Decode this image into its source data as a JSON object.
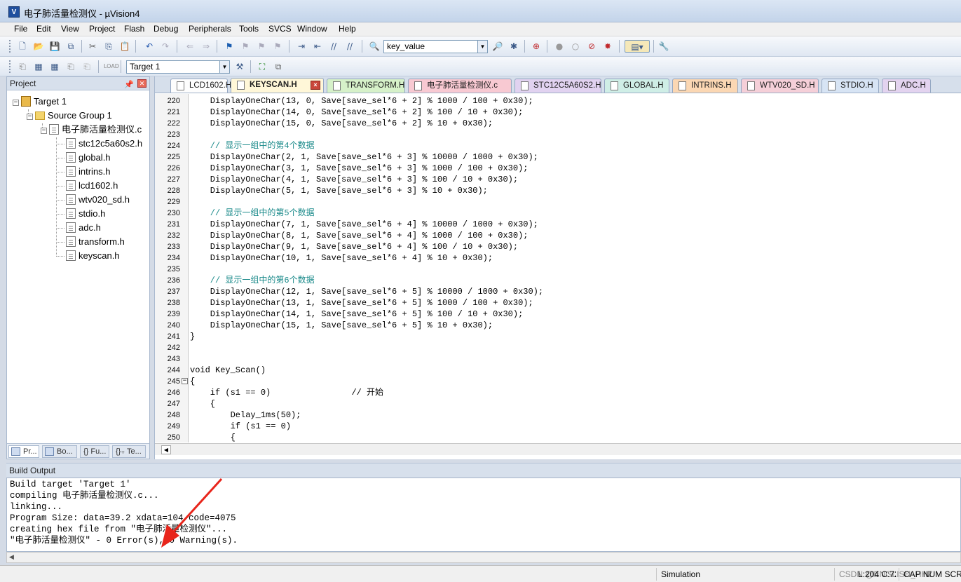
{
  "window": {
    "title": "电子肺活量检测仪  - µVision4",
    "app_icon_label": "V"
  },
  "menu": [
    "File",
    "Edit",
    "View",
    "Project",
    "Flash",
    "Debug",
    "Peripherals",
    "Tools",
    "SVCS",
    "Window",
    "Help"
  ],
  "toolbar": {
    "find_combo_value": "key_value",
    "target_combo_value": "Target 1"
  },
  "project_panel": {
    "title": "Project",
    "tree": {
      "target": "Target 1",
      "group": "Source Group 1",
      "main_file": "电子肺活量检测仪.c",
      "headers": [
        "stc12c5a60s2.h",
        "global.h",
        "intrins.h",
        "lcd1602.h",
        "wtv020_sd.h",
        "stdio.h",
        "adc.h",
        "transform.h",
        "keyscan.h"
      ]
    },
    "tabs": [
      "Pr...",
      "Bo...",
      "{} Fu...",
      "{}₊ Te..."
    ]
  },
  "editor": {
    "tabs": [
      {
        "label": "LCD1602.H",
        "color": "#fdfdfd"
      },
      {
        "label": "KEYSCAN.H",
        "color": "#fff7d8",
        "active": true
      },
      {
        "label": "TRANSFORM.H",
        "color": "#d6f1c9"
      },
      {
        "label": "电子肺活量检测仪.c",
        "color": "#f8c9d2"
      },
      {
        "label": "STC12C5A60S2.H",
        "color": "#e1d2f0"
      },
      {
        "label": "GLOBAL.H",
        "color": "#cfeee6"
      },
      {
        "label": "INTRINS.H",
        "color": "#fbd7b3"
      },
      {
        "label": "WTV020_SD.H",
        "color": "#f5cfd8"
      },
      {
        "label": "STDIO.H",
        "color": "#d7e4f4"
      },
      {
        "label": "ADC.H",
        "color": "#e3d3ef"
      }
    ],
    "lines": [
      {
        "n": "220",
        "t": "    DisplayOneChar(13, 0, Save[save_sel*6 + 2] % 1000 / 100 + 0x30);"
      },
      {
        "n": "221",
        "t": "    DisplayOneChar(14, 0, Save[save_sel*6 + 2] % 100 / 10 + 0x30);"
      },
      {
        "n": "222",
        "t": "    DisplayOneChar(15, 0, Save[save_sel*6 + 2] % 10 + 0x30);"
      },
      {
        "n": "223",
        "t": ""
      },
      {
        "n": "224",
        "t": "    // 显示一组中的第4个数据",
        "comment": true
      },
      {
        "n": "225",
        "t": "    DisplayOneChar(2, 1, Save[save_sel*6 + 3] % 10000 / 1000 + 0x30);"
      },
      {
        "n": "226",
        "t": "    DisplayOneChar(3, 1, Save[save_sel*6 + 3] % 1000 / 100 + 0x30);"
      },
      {
        "n": "227",
        "t": "    DisplayOneChar(4, 1, Save[save_sel*6 + 3] % 100 / 10 + 0x30);"
      },
      {
        "n": "228",
        "t": "    DisplayOneChar(5, 1, Save[save_sel*6 + 3] % 10 + 0x30);"
      },
      {
        "n": "229",
        "t": ""
      },
      {
        "n": "230",
        "t": "    // 显示一组中的第5个数据",
        "comment": true
      },
      {
        "n": "231",
        "t": "    DisplayOneChar(7, 1, Save[save_sel*6 + 4] % 10000 / 1000 + 0x30);"
      },
      {
        "n": "232",
        "t": "    DisplayOneChar(8, 1, Save[save_sel*6 + 4] % 1000 / 100 + 0x30);"
      },
      {
        "n": "233",
        "t": "    DisplayOneChar(9, 1, Save[save_sel*6 + 4] % 100 / 10 + 0x30);"
      },
      {
        "n": "234",
        "t": "    DisplayOneChar(10, 1, Save[save_sel*6 + 4] % 10 + 0x30);"
      },
      {
        "n": "235",
        "t": ""
      },
      {
        "n": "236",
        "t": "    // 显示一组中的第6个数据",
        "comment": true
      },
      {
        "n": "237",
        "t": "    DisplayOneChar(12, 1, Save[save_sel*6 + 5] % 10000 / 1000 + 0x30);"
      },
      {
        "n": "238",
        "t": "    DisplayOneChar(13, 1, Save[save_sel*6 + 5] % 1000 / 100 + 0x30);"
      },
      {
        "n": "239",
        "t": "    DisplayOneChar(14, 1, Save[save_sel*6 + 5] % 100 / 10 + 0x30);"
      },
      {
        "n": "240",
        "t": "    DisplayOneChar(15, 1, Save[save_sel*6 + 5] % 10 + 0x30);"
      },
      {
        "n": "241",
        "t": "}"
      },
      {
        "n": "242",
        "t": ""
      },
      {
        "n": "243",
        "t": ""
      },
      {
        "n": "244",
        "t": "void Key_Scan()"
      },
      {
        "n": "245",
        "t": "{",
        "fold": true
      },
      {
        "n": "246",
        "t": "    if (s1 == 0)                // 开始"
      },
      {
        "n": "247",
        "t": "    {"
      },
      {
        "n": "248",
        "t": "        Delay_1ms(50);"
      },
      {
        "n": "249",
        "t": "        if (s1 == 0)"
      },
      {
        "n": "250",
        "t": "        {"
      }
    ]
  },
  "build_output": {
    "title": "Build Output",
    "lines": [
      "Build target 'Target 1'",
      "compiling 电子肺活量检测仪.c...",
      "linking...",
      "Program Size: data=39.2 xdata=104 code=4075",
      "creating hex file from \"电子肺活量检测仪\"...",
      "\"电子肺活量检测仪\" - 0 Error(s), 0 Warning(s)."
    ]
  },
  "status_bar": {
    "mode": "Simulation",
    "position": "L:204 C:72",
    "indicators": "CAP  NUM  SCRL",
    "watermark": "CSDN @ENGLISH_HHZ"
  },
  "colors": {
    "annotation_arrow": "#e8251b",
    "comment": "#1a8a8a"
  }
}
